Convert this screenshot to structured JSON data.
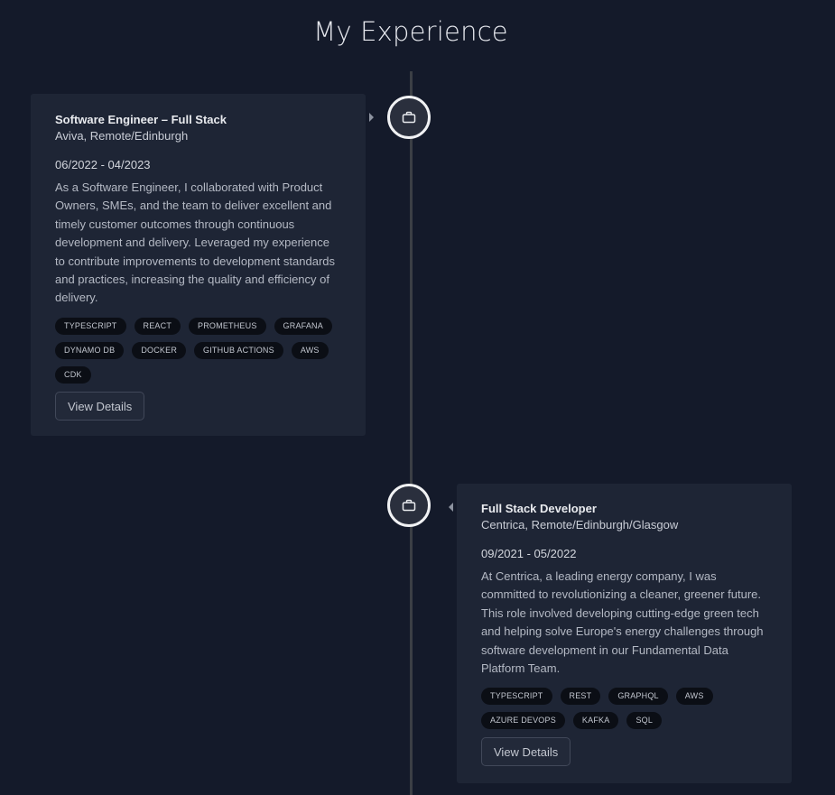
{
  "page": {
    "title": "My Experience"
  },
  "experiences": [
    {
      "title": "Software Engineer – Full Stack",
      "company": "Aviva, Remote/Edinburgh",
      "dates": "06/2022 - 04/2023",
      "description": "As a Software Engineer, I collaborated with Product Owners, SMEs, and the team to deliver excellent and timely customer outcomes through continuous development and delivery. Leveraged my experience to contribute improvements to development standards and practices, increasing the quality and efficiency of delivery.",
      "tags": [
        "TYPESCRIPT",
        "REACT",
        "PROMETHEUS",
        "GRAFANA",
        "DYNAMO DB",
        "DOCKER",
        "GITHUB ACTIONS",
        "AWS",
        "CDK"
      ],
      "button_label": "View Details",
      "icon": "briefcase-icon"
    },
    {
      "title": "Full Stack Developer",
      "company": "Centrica, Remote/Edinburgh/Glasgow",
      "dates": "09/2021 - 05/2022",
      "description": "At Centrica, a leading energy company, I was committed to revolutionizing a cleaner, greener future. This role involved developing cutting-edge green tech and helping solve Europe's energy challenges through software development in our Fundamental Data Platform Team.",
      "tags": [
        "TYPESCRIPT",
        "REST",
        "GRAPHQL",
        "AWS",
        "AZURE DEVOPS",
        "KAFKA",
        "SQL"
      ],
      "button_label": "View Details",
      "icon": "briefcase-icon"
    }
  ],
  "colors": {
    "background": "#141a2a",
    "card": "#1e2535",
    "timeline": "#3b3f45",
    "node_border": "#f1f2f4",
    "tag_bg": "#0b0e15"
  }
}
